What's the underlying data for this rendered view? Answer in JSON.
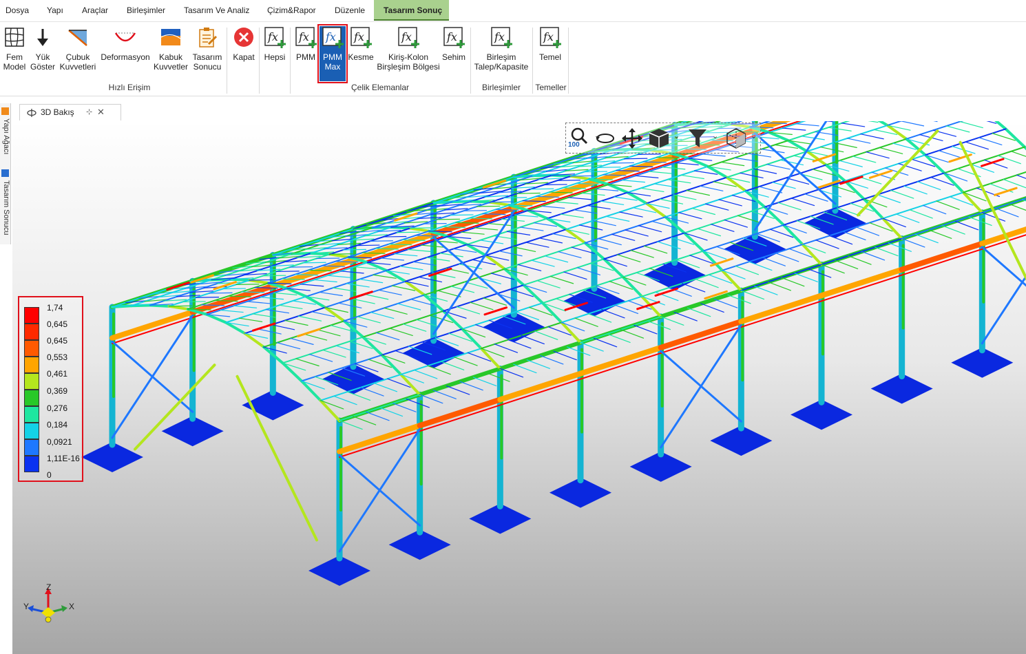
{
  "menu": [
    {
      "label": "Dosya"
    },
    {
      "label": "Yapı"
    },
    {
      "label": "Araçlar"
    },
    {
      "label": "Birleşimler"
    },
    {
      "label": "Tasarım Ve Analiz"
    },
    {
      "label": "Çizim&Rapor"
    },
    {
      "label": "Düzenle"
    },
    {
      "label": "Tasarım Sonuç"
    }
  ],
  "ribbon": {
    "buttons": [
      {
        "l1": "Fem",
        "l2": "Model"
      },
      {
        "l1": "Yük",
        "l2": "Göster"
      },
      {
        "l1": "Çubuk",
        "l2": "Kuvvetleri"
      },
      {
        "l1": "Deformasyon",
        "l2": ""
      },
      {
        "l1": "Kabuk",
        "l2": "Kuvvetler"
      },
      {
        "l1": "Tasarım",
        "l2": "Sonucu"
      },
      {
        "l1": "Kapat",
        "l2": ""
      },
      {
        "l1": "Hepsi",
        "l2": ""
      },
      {
        "l1": "PMM",
        "l2": ""
      },
      {
        "l1": "PMM",
        "l2": "Max"
      },
      {
        "l1": "Kesme",
        "l2": ""
      },
      {
        "l1": "Kiriş-Kolon",
        "l2": "Birşleşim Bölgesi"
      },
      {
        "l1": "Sehim",
        "l2": ""
      },
      {
        "l1": "Birleşim",
        "l2": "Talep/Kapasite"
      },
      {
        "l1": "Temel",
        "l2": ""
      }
    ],
    "groups": [
      {
        "label": "Hızlı Erişim"
      },
      {
        "label": "Çelik Elemanlar"
      },
      {
        "label": "Birleşimler"
      },
      {
        "label": "Temeller"
      }
    ]
  },
  "side_tabs": [
    {
      "label": "Yapı Ağacı"
    },
    {
      "label": "Tasarım Sonucu"
    }
  ],
  "document_tab": {
    "label": "3D Bakış"
  },
  "view_toolbar": {
    "zoom_level": "100"
  },
  "legend": {
    "labels": [
      "1,74",
      "0,645",
      "0,645",
      "0,553",
      "0,461",
      "0,369",
      "0,276",
      "0,184",
      "0,0921",
      "1,11E-16",
      "0"
    ],
    "colors": [
      "#ff0000",
      "#ff2a00",
      "#ff5a00",
      "#ffa500",
      "#b4e61e",
      "#28c828",
      "#1ee6a0",
      "#14d2e6",
      "#1e78ff",
      "#0a32f0",
      "#0000ff"
    ]
  },
  "axes": {
    "z": "Z",
    "y": "Y",
    "x": "X"
  }
}
